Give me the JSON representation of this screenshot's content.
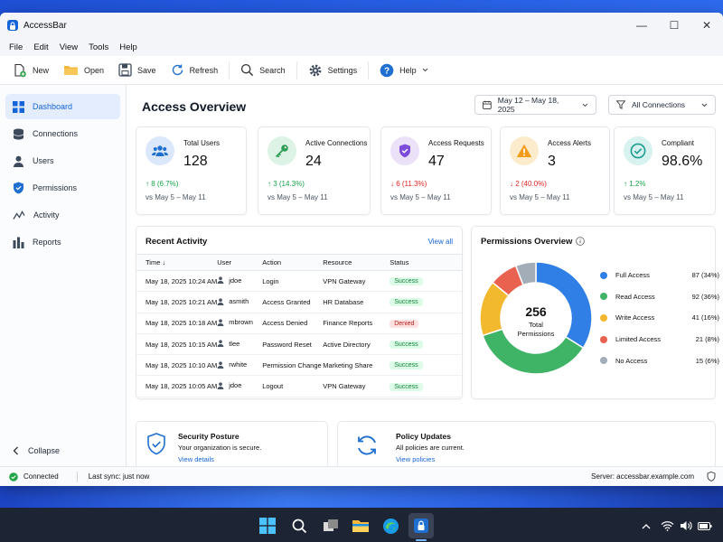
{
  "window": {
    "title": "AccessBar",
    "minimize": "—",
    "maximize": "☐",
    "close": "✕"
  },
  "menu": [
    "File",
    "Edit",
    "View",
    "Tools",
    "Help"
  ],
  "toolbar": {
    "new": "New",
    "open": "Open",
    "save": "Save",
    "refresh": "Refresh",
    "search": "Search",
    "settings": "Settings",
    "help": "Help"
  },
  "sidebar": {
    "items": [
      {
        "label": "Dashboard",
        "icon": "grid-icon",
        "active": true
      },
      {
        "label": "Connections",
        "icon": "database-icon"
      },
      {
        "label": "Users",
        "icon": "user-icon"
      },
      {
        "label": "Permissions",
        "icon": "shield-icon"
      },
      {
        "label": "Activity",
        "icon": "activity-icon"
      },
      {
        "label": "Reports",
        "icon": "bar-chart-icon"
      }
    ],
    "collapse": "Collapse"
  },
  "header": {
    "title": "Access Overview",
    "date_range": "May 12 – May 18, 2025",
    "connection_filter": "All Connections"
  },
  "stats": [
    {
      "label": "Total Users",
      "value": "128",
      "change": "↑ 8 (6.7%)",
      "direction": "up",
      "compare": "vs May 5 – May 11",
      "color": "#dbe7fb"
    },
    {
      "label": "Active Connections",
      "value": "24",
      "change": "↑ 3 (14.3%)",
      "direction": "up",
      "compare": "vs May 5 – May 11",
      "color": "#dcf3e6"
    },
    {
      "label": "Access Requests",
      "value": "47",
      "change": "↓ 6 (11.3%)",
      "direction": "down",
      "compare": "vs May 5 – May 11",
      "color": "#ebe2fa"
    },
    {
      "label": "Access Alerts",
      "value": "3",
      "change": "↓ 2 (40.0%)",
      "direction": "down",
      "compare": "vs May 5 – May 11",
      "color": "#fdeccc"
    },
    {
      "label": "Compliant",
      "value": "98.6%",
      "change": "↑ 1.2%",
      "direction": "up",
      "compare": "vs May 5 – May 11",
      "color": "#d7f2ef"
    }
  ],
  "activity": {
    "title": "Recent Activity",
    "view_all": "View all",
    "columns": [
      "Time ↓",
      "User",
      "Action",
      "Resource",
      "Status"
    ],
    "rows": [
      {
        "time": "May 18, 2025 10:24 AM",
        "user": "jdoe",
        "action": "Login",
        "resource": "VPN Gateway",
        "status": "Success"
      },
      {
        "time": "May 18, 2025 10:21 AM",
        "user": "asmith",
        "action": "Access Granted",
        "resource": "HR Database",
        "status": "Success"
      },
      {
        "time": "May 18, 2025 10:18 AM",
        "user": "mbrown",
        "action": "Access Denied",
        "resource": "Finance Reports",
        "status": "Denied"
      },
      {
        "time": "May 18, 2025 10:15 AM",
        "user": "tlee",
        "action": "Password Reset",
        "resource": "Active Directory",
        "status": "Success"
      },
      {
        "time": "May 18, 2025 10:10 AM",
        "user": "rwhite",
        "action": "Permission Change",
        "resource": "Marketing Share",
        "status": "Success"
      },
      {
        "time": "May 18, 2025 10:05 AM",
        "user": "jdoe",
        "action": "Logout",
        "resource": "VPN Gateway",
        "status": "Success"
      }
    ]
  },
  "permissions": {
    "title": "Permissions Overview",
    "total": "256",
    "total_label_1": "Total",
    "total_label_2": "Permissions",
    "segments": [
      {
        "name": "Full Access",
        "value": 87,
        "display": "87 (34%)",
        "color": "#2f7fe6"
      },
      {
        "name": "Read Access",
        "value": 92,
        "display": "92 (36%)",
        "color": "#3fb467"
      },
      {
        "name": "Write Access",
        "value": 41,
        "display": "41 (16%)",
        "color": "#f2b92f"
      },
      {
        "name": "Limited Access",
        "value": 21,
        "display": "21 (8%)",
        "color": "#e9614f"
      },
      {
        "name": "No Access",
        "value": 15,
        "display": "15 (6%)",
        "color": "#a3adb8"
      }
    ]
  },
  "security": {
    "title": "Security Posture",
    "text": "Your organization is secure.",
    "link": "View details"
  },
  "policy": {
    "title": "Policy Updates",
    "text": "All policies are current.",
    "link": "View policies"
  },
  "status": {
    "connection": "Connected",
    "sync": "Last sync: just now",
    "server": "Server: accessbar.example.com"
  }
}
